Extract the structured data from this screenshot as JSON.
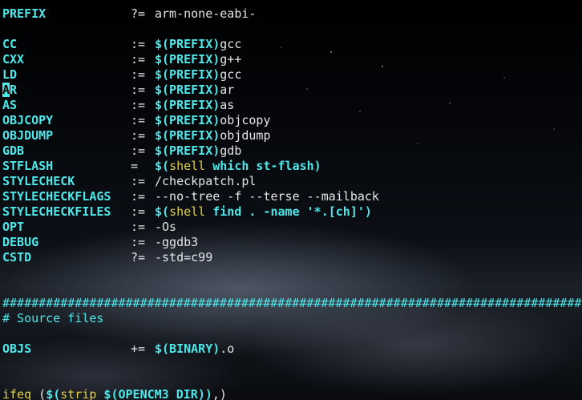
{
  "assignments_top": [
    {
      "name": "PREFIX",
      "op": "?=",
      "value": [
        {
          "t": "val",
          "s": "arm-none-eabi-"
        }
      ]
    }
  ],
  "assignments": [
    {
      "name": "CC",
      "op": ":=",
      "value": [
        {
          "t": "ref",
          "s": "$(PREFIX)"
        },
        {
          "t": "val",
          "s": "gcc"
        }
      ]
    },
    {
      "name": "CXX",
      "op": ":=",
      "value": [
        {
          "t": "ref",
          "s": "$(PREFIX)"
        },
        {
          "t": "val",
          "s": "g++"
        }
      ]
    },
    {
      "name": "LD",
      "op": ":=",
      "value": [
        {
          "t": "ref",
          "s": "$(PREFIX)"
        },
        {
          "t": "val",
          "s": "gcc"
        }
      ]
    },
    {
      "name": "AR",
      "op": ":=",
      "value": [
        {
          "t": "ref",
          "s": "$(PREFIX)"
        },
        {
          "t": "val",
          "s": "ar"
        }
      ]
    },
    {
      "name": "AS",
      "op": ":=",
      "value": [
        {
          "t": "ref",
          "s": "$(PREFIX)"
        },
        {
          "t": "val",
          "s": "as"
        }
      ]
    },
    {
      "name": "OBJCOPY",
      "op": ":=",
      "value": [
        {
          "t": "ref",
          "s": "$(PREFIX)"
        },
        {
          "t": "val",
          "s": "objcopy"
        }
      ]
    },
    {
      "name": "OBJDUMP",
      "op": ":=",
      "value": [
        {
          "t": "ref",
          "s": "$(PREFIX)"
        },
        {
          "t": "val",
          "s": "objdump"
        }
      ]
    },
    {
      "name": "GDB",
      "op": ":=",
      "value": [
        {
          "t": "ref",
          "s": "$(PREFIX)"
        },
        {
          "t": "val",
          "s": "gdb"
        }
      ]
    },
    {
      "name": "STFLASH",
      "op": "=",
      "value": [
        {
          "t": "ref",
          "s": "$("
        },
        {
          "t": "func",
          "s": "shell"
        },
        {
          "t": "ref",
          "s": " which st-flash)"
        }
      ]
    },
    {
      "name": "STYLECHECK",
      "op": ":=",
      "value": [
        {
          "t": "val",
          "s": "/checkpatch.pl"
        }
      ]
    },
    {
      "name": "STYLECHECKFLAGS",
      "op": ":=",
      "value": [
        {
          "t": "val",
          "s": "--no-tree -f --terse --mailback"
        }
      ]
    },
    {
      "name": "STYLECHECKFILES",
      "op": ":=",
      "value": [
        {
          "t": "ref",
          "s": "$("
        },
        {
          "t": "func",
          "s": "shell"
        },
        {
          "t": "ref",
          "s": " find . -name '*.[ch]')"
        }
      ]
    },
    {
      "name": "OPT",
      "op": ":=",
      "value": [
        {
          "t": "val",
          "s": "-Os"
        }
      ]
    },
    {
      "name": "DEBUG",
      "op": ":=",
      "value": [
        {
          "t": "val",
          "s": "-ggdb3"
        }
      ]
    },
    {
      "name": "CSTD",
      "op": "?=",
      "value": [
        {
          "t": "val",
          "s": "-std=c99"
        }
      ]
    }
  ],
  "separator": "################################################################################",
  "comment": "# Source files",
  "objs": {
    "name": "OBJS",
    "op": "+=",
    "value": [
      {
        "t": "ref",
        "s": "$(BINARY)"
      },
      {
        "t": "val",
        "s": ".o"
      }
    ]
  },
  "ifeq_line": [
    {
      "t": "kw",
      "s": "ifeq"
    },
    {
      "t": "val",
      "s": " ("
    },
    {
      "t": "ref",
      "s": "$("
    },
    {
      "t": "func",
      "s": "strip"
    },
    {
      "t": "ref",
      "s": " $(OPENCM3_DIR)"
    },
    {
      "t": "ref",
      "s": ")"
    },
    {
      "t": "val",
      "s": ",)"
    }
  ],
  "cursor": {
    "line": "AR",
    "char_index": 0
  },
  "colors": {
    "identifier": "#4ee8ea",
    "function": "#e0d04a",
    "text": "#e6e6e6",
    "background": "#000000"
  }
}
